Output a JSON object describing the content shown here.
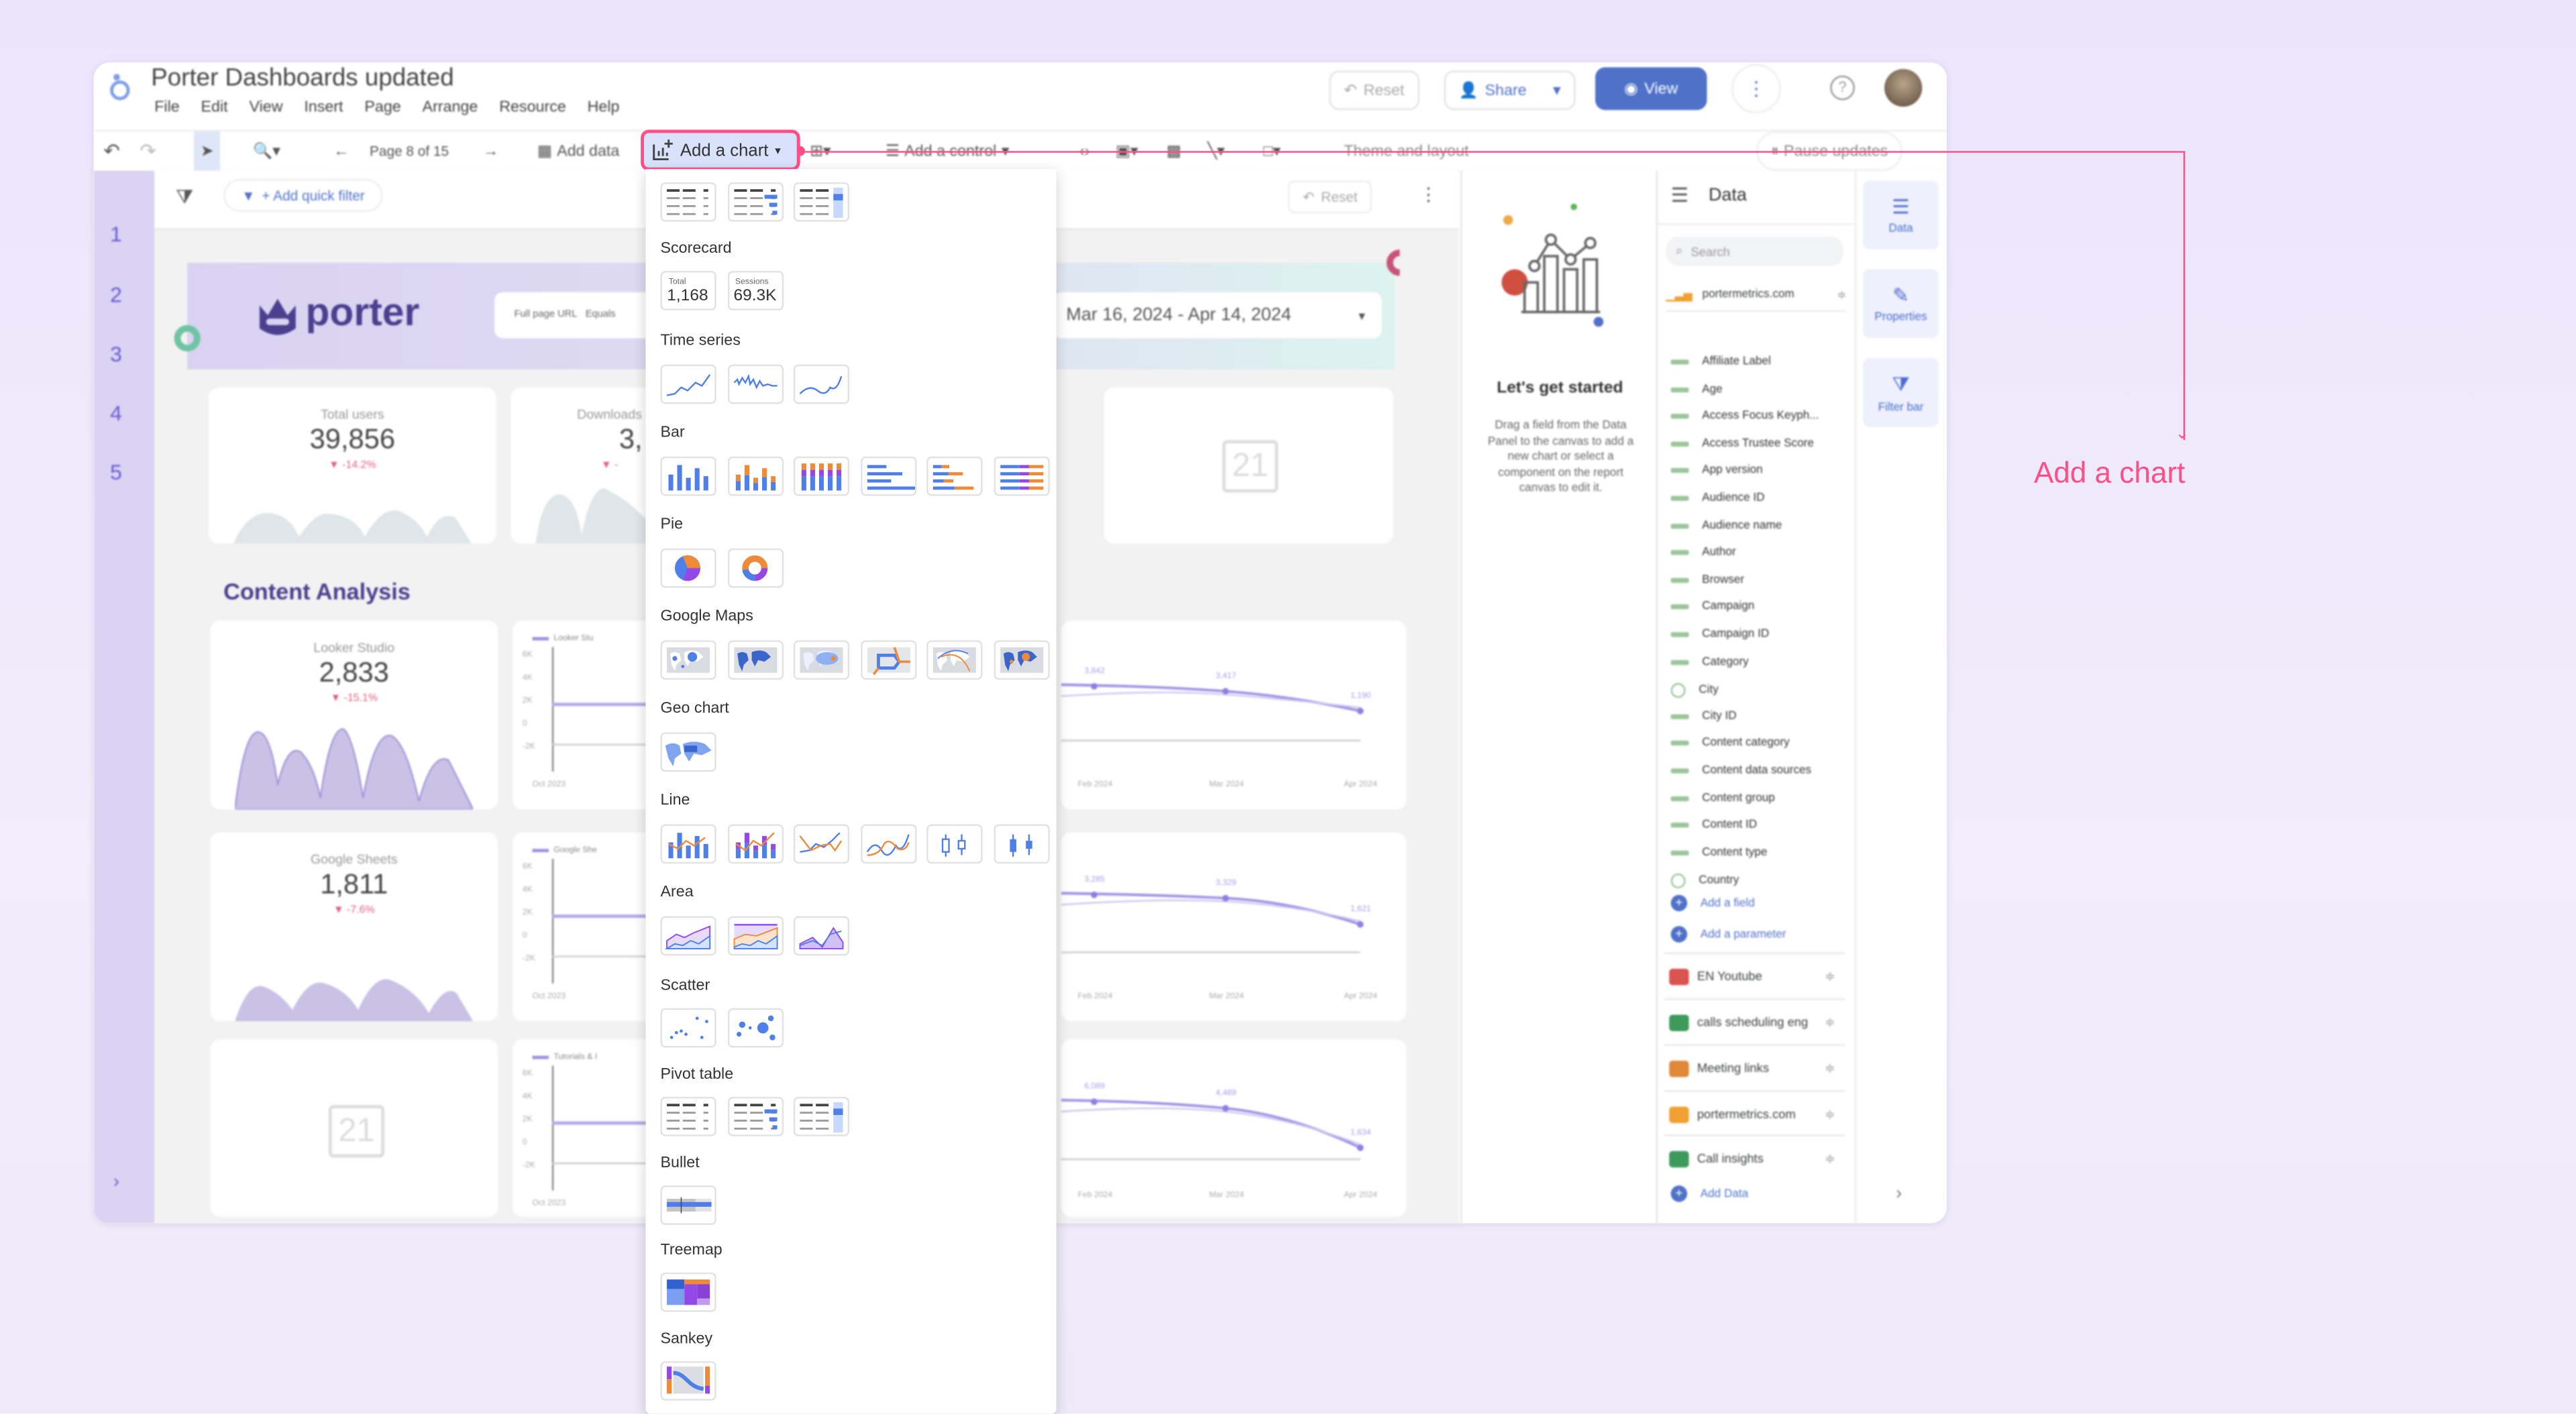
{
  "app": {
    "title": "Porter Dashboards updated",
    "menu": [
      "File",
      "Edit",
      "View",
      "Insert",
      "Page",
      "Arrange",
      "Resource",
      "Help"
    ],
    "reset_label": "Reset",
    "share_label": "Share",
    "view_label": "View"
  },
  "toolbar": {
    "page_indicator": "Page 8 of 15",
    "add_data_label": "Add data",
    "add_chart_label": "Add a chart",
    "add_control_label": "Add a control",
    "theme_label": "Theme and layout",
    "pause_label": "Pause updates"
  },
  "pages": [
    "1",
    "2",
    "3",
    "4",
    "5"
  ],
  "filterbar": {
    "add_filter_label": "+ Add quick filter",
    "reset_label": "Reset"
  },
  "report": {
    "logo_text": "porter",
    "filter_field": "Full page URL",
    "filter_op": "Equals",
    "date_range": "Mar 16, 2024 - Apr 14, 2024",
    "section_title": "Content Analysis",
    "scorecards": [
      {
        "label": "Total users",
        "value": "39,856",
        "delta": "▼ -14.2%"
      },
      {
        "label": "Downloads",
        "value": "3,",
        "delta": "▼ -"
      },
      {
        "label": "Looker Studio",
        "value": "2,833",
        "delta": "▼ -15.1%"
      },
      {
        "label": "Google Sheets",
        "value": "1,811",
        "delta": "▼ -7.6%"
      }
    ],
    "placeholder_icon_text": "21",
    "mini_legends": [
      "Looker Stu",
      "Google She",
      "Tutorials & I"
    ],
    "y_ticks": [
      "6K",
      "4K",
      "2K",
      "0",
      "-2K"
    ],
    "x_first": "Oct 2023",
    "x_ticks": [
      "Feb 2024",
      "Mar 2024",
      "Apr 2024"
    ],
    "point_labels": [
      [
        "3,842",
        "3,417",
        "1,190"
      ],
      [
        "3,285",
        "3,329",
        "1,621"
      ],
      [
        "6,089",
        "4,489",
        "1,634"
      ]
    ]
  },
  "get_started": {
    "title": "Let's get started",
    "body": "Drag a field from the Data Panel to the canvas to add a new chart or select a component on the report canvas to edit it."
  },
  "data_panel": {
    "title": "Data",
    "search_placeholder": "Search",
    "primary_source": "portermetrics.com",
    "fields": [
      "Affiliate Label",
      "Age",
      "Access Focus Keyph...",
      "Access Trustee Score",
      "App version",
      "Audience ID",
      "Audience name",
      "Author",
      "Browser",
      "Campaign",
      "Campaign ID",
      "Category",
      "City",
      "City ID",
      "Content category",
      "Content data sources",
      "Content group",
      "Content ID",
      "Content type",
      "Country"
    ],
    "add_field": "Add a field",
    "add_parameter": "Add a parameter",
    "sources": [
      {
        "name": "EN Youtube",
        "color": "#d9534f"
      },
      {
        "name": "calls scheduling eng",
        "color": "#3d9a5b"
      },
      {
        "name": "Meeting links",
        "color": "#e0883a"
      },
      {
        "name": "portermetrics.com",
        "color": "#f0a030"
      },
      {
        "name": "Call insights",
        "color": "#3d9a5b"
      }
    ],
    "add_data": "Add Data"
  },
  "side_tabs": [
    "Data",
    "Properties",
    "Filter bar"
  ],
  "chart_menu": {
    "sections": [
      {
        "label": "",
        "tiles": [
          "table",
          "table-bars",
          "table-heatmap"
        ]
      },
      {
        "label": "Scorecard",
        "tiles": [
          "scorecard-total",
          "scorecard-compact"
        ],
        "scorecards": [
          {
            "caption": "Total",
            "value": "1,168"
          },
          {
            "caption": "Sessions",
            "value": "69.3K"
          }
        ]
      },
      {
        "label": "Time series",
        "tiles": [
          "time-series",
          "sparkline",
          "smoothed-time-series"
        ]
      },
      {
        "label": "Bar",
        "tiles": [
          "column",
          "stacked-column",
          "100-stacked-column",
          "bar",
          "stacked-bar",
          "100-stacked-bar"
        ]
      },
      {
        "label": "Pie",
        "tiles": [
          "pie",
          "donut"
        ]
      },
      {
        "label": "Google Maps",
        "tiles": [
          "bubble-map",
          "filled-map",
          "heatmap-map",
          "line-map",
          "arc-map",
          "combo-map"
        ]
      },
      {
        "label": "Geo chart",
        "tiles": [
          "geo-chart"
        ]
      },
      {
        "label": "Line",
        "tiles": [
          "combo",
          "stacked-combo",
          "line",
          "smoothed-line",
          "candlestick-hollow",
          "candlestick"
        ]
      },
      {
        "label": "Area",
        "tiles": [
          "area",
          "stacked-area",
          "100-area"
        ]
      },
      {
        "label": "Scatter",
        "tiles": [
          "scatter",
          "bubble"
        ]
      },
      {
        "label": "Pivot table",
        "tiles": [
          "pivot",
          "pivot-bars",
          "pivot-heatmap"
        ]
      },
      {
        "label": "Bullet",
        "tiles": [
          "bullet"
        ]
      },
      {
        "label": "Treemap",
        "tiles": [
          "treemap"
        ]
      },
      {
        "label": "Sankey",
        "tiles": [
          "sankey"
        ]
      }
    ]
  },
  "annotation": {
    "label": "Add a chart",
    "color": "#ff4f86"
  },
  "colors": {
    "accent_blue": "#4f7fe8",
    "orange": "#ee8a3a",
    "purple": "#9548e8",
    "brand_purple": "#4b3f8f",
    "view_button": "#4f72c8"
  }
}
